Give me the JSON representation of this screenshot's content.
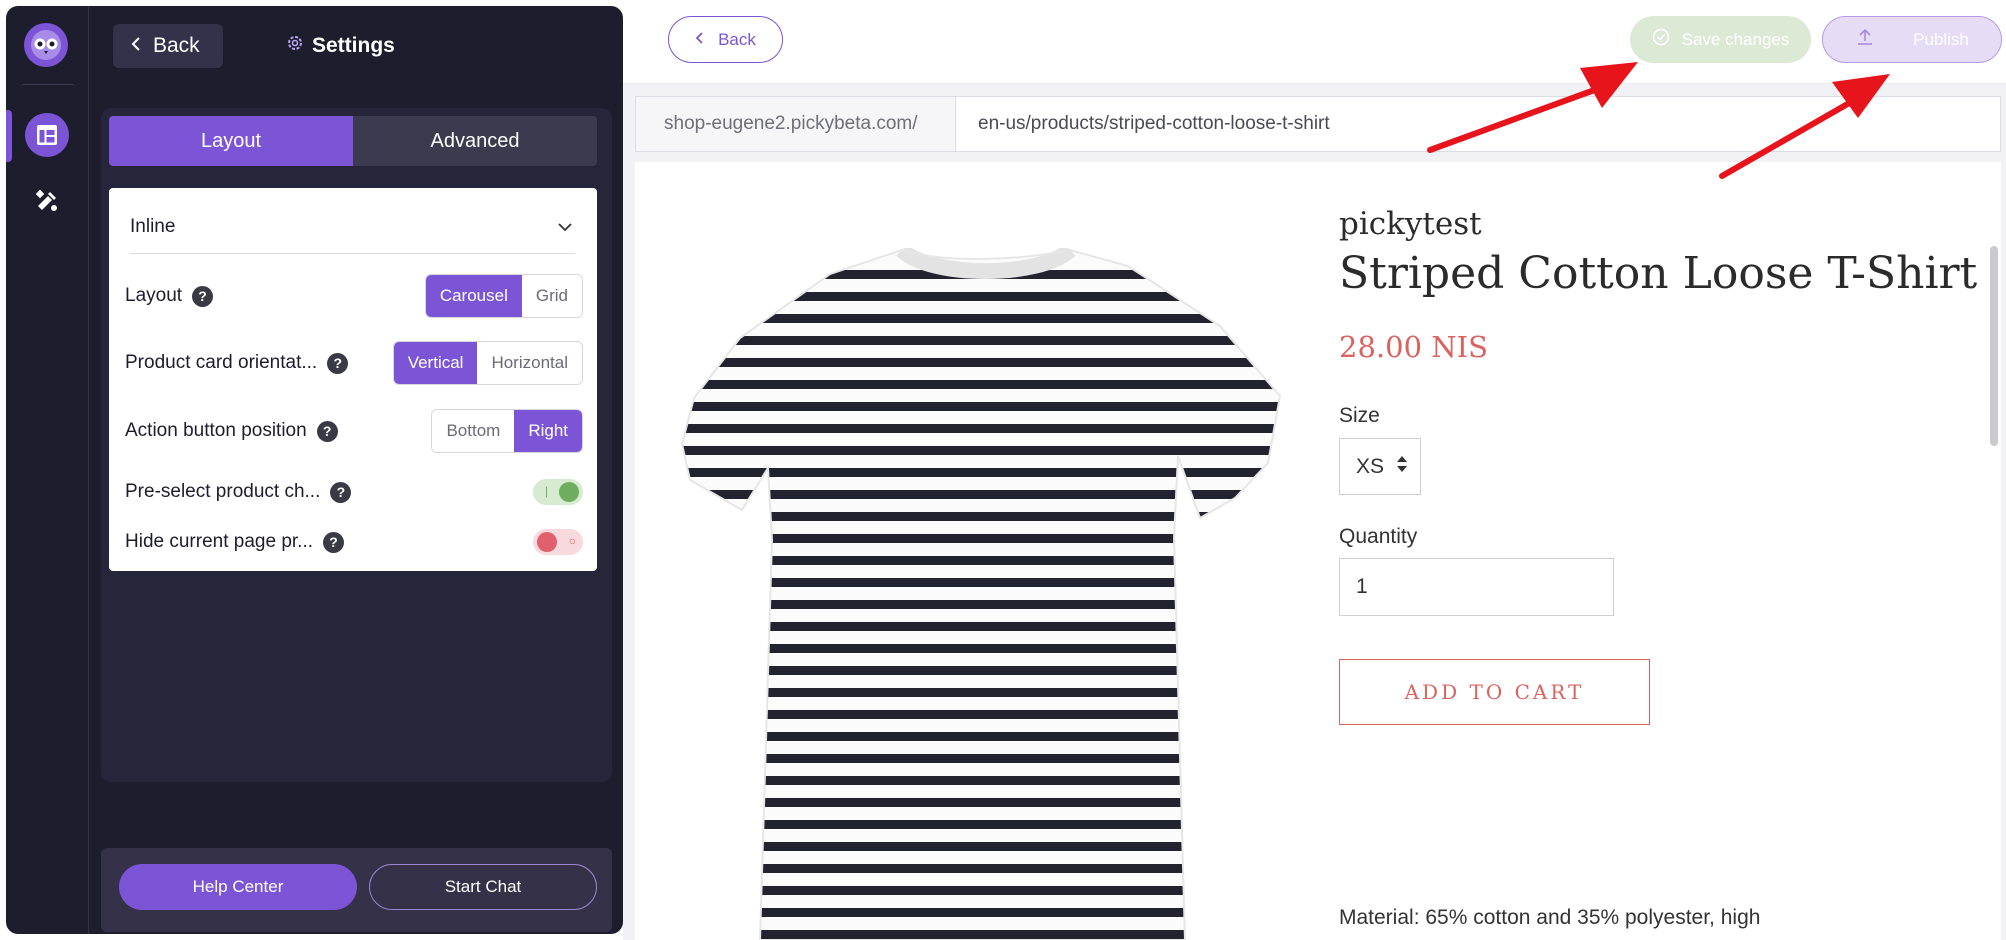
{
  "sidebar": {
    "back_label": "Back",
    "settings_title": "Settings",
    "tabs": [
      {
        "label": "Layout",
        "active": true
      },
      {
        "label": "Advanced",
        "active": false
      }
    ],
    "widget_type": "Inline",
    "rows": {
      "layout": {
        "label": "Layout",
        "options": [
          "Carousel",
          "Grid"
        ],
        "selected": "Carousel"
      },
      "orientation": {
        "label": "Product card orientat...",
        "options": [
          "Vertical",
          "Horizontal"
        ],
        "selected": "Vertical"
      },
      "action_position": {
        "label": "Action button position",
        "options": [
          "Bottom",
          "Right"
        ],
        "selected": "Right"
      },
      "preselect": {
        "label": "Pre-select product ch...",
        "enabled": true
      },
      "hide_current": {
        "label": "Hide current page pr...",
        "enabled": false
      }
    },
    "help_center_label": "Help Center",
    "start_chat_label": "Start Chat"
  },
  "topbar": {
    "back_label": "Back",
    "save_label": "Save changes",
    "publish_label": "Publish"
  },
  "url": {
    "domain": "shop-eugene2.pickybeta.com/",
    "path": "en-us/products/striped-cotton-loose-t-shirt"
  },
  "product": {
    "vendor": "pickytest",
    "title": "Striped Cotton Loose T-Shirt",
    "price": "28.00 NIS",
    "size_label": "Size",
    "size_value": "XS",
    "quantity_label": "Quantity",
    "quantity_value": "1",
    "add_to_cart_label": "ADD TO CART",
    "material_text": "Material: 65% cotton and 35% polyester, high"
  },
  "colors": {
    "accent": "#7b55d6",
    "sidebar_bg": "#1e1d2e",
    "price": "#d9635f",
    "annotation_arrow": "#e8141b"
  }
}
